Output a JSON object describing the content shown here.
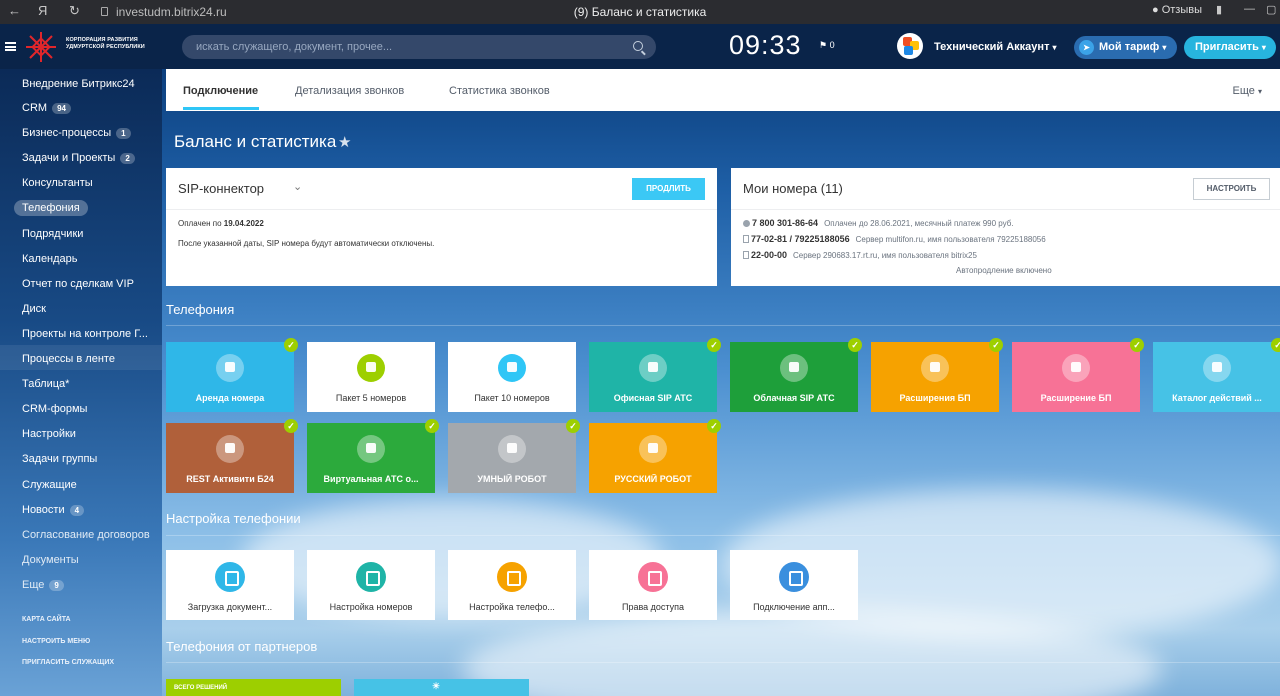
{
  "browser": {
    "url": "investudm.bitrix24.ru",
    "tab_title": "(9) Баланс и статистика",
    "feedback": "Отзывы"
  },
  "header": {
    "logo_line1": "КОРПОРАЦИЯ РАЗВИТИЯ",
    "logo_line2": "УДМУРТСКОЙ РЕСПУБЛИКИ",
    "search_placeholder": "искать служащего, документ, прочее...",
    "clock": "09:33",
    "flag_count": "0",
    "account_name": "Технический Аккаунт",
    "tariff_label": "Мой тариф",
    "invite_label": "Пригласить"
  },
  "sidebar": {
    "items": [
      {
        "label": "Внедрение Битрикс24",
        "count": ""
      },
      {
        "label": "CRM",
        "count": "94"
      },
      {
        "label": "Бизнес-процессы",
        "count": "1"
      },
      {
        "label": "Задачи и Проекты",
        "count": "2"
      },
      {
        "label": "Консультанты",
        "count": ""
      },
      {
        "label": "Телефония",
        "count": ""
      },
      {
        "label": "Подрядчики",
        "count": ""
      },
      {
        "label": "Календарь",
        "count": ""
      },
      {
        "label": "Отчет по сделкам VIP",
        "count": ""
      },
      {
        "label": "Диск",
        "count": ""
      },
      {
        "label": "Проекты на контроле Г...",
        "count": ""
      },
      {
        "label": "Процессы в ленте",
        "count": ""
      },
      {
        "label": "Таблица*",
        "count": ""
      },
      {
        "label": "CRM-формы",
        "count": ""
      },
      {
        "label": "Настройки",
        "count": ""
      },
      {
        "label": "Задачи группы",
        "count": ""
      },
      {
        "label": "Служащие",
        "count": ""
      },
      {
        "label": "Новости",
        "count": "4"
      },
      {
        "label": "Согласование договоров",
        "count": ""
      },
      {
        "label": "Документы",
        "count": ""
      },
      {
        "label": "Еще",
        "count": "9"
      }
    ],
    "links": [
      "КАРТА САЙТА",
      "НАСТРОИТЬ МЕНЮ",
      "ПРИГЛАСИТЬ СЛУЖАЩИХ"
    ]
  },
  "tabs": {
    "items": [
      "Подключение",
      "Детализация звонков",
      "Статистика звонков"
    ],
    "more": "Еще"
  },
  "page_title": "Баланс и статистика",
  "sip_card": {
    "title": "SIP-коннектор",
    "button": "ПРОДЛИТЬ",
    "paid_prefix": "Оплачен по",
    "paid_date": "19.04.2022",
    "note": "После указанной даты, SIP номера будут автоматически отключены."
  },
  "numbers_card": {
    "title": "Мои номера (11)",
    "button": "НАСТРОИТЬ",
    "rows": [
      {
        "number": "7 800 301-86-64",
        "desc": "Оплачен до 28.06.2021, месячный платеж 990 руб."
      },
      {
        "number": "77-02-81 / 79225188056",
        "desc": "Сервер multifon.ru, имя пользователя 79225188056"
      },
      {
        "number": "22-00-00",
        "desc": "Сервер 290683.17.rt.ru, имя пользователя bitrix25"
      }
    ],
    "autorenew": "Автопродление включено"
  },
  "sections": {
    "telephony": "Телефония",
    "settings": "Настройка телефонии",
    "partners": "Телефония от партнеров"
  },
  "telephony_tiles": [
    {
      "label": "Аренда номера",
      "color": "#2fb7e8"
    },
    {
      "label": "Пакет 5 номеров",
      "color": "#ffffff"
    },
    {
      "label": "Пакет 10 номеров",
      "color": "#ffffff"
    },
    {
      "label": "Офисная SIP АТС",
      "color": "#1fb4a7"
    },
    {
      "label": "Облачная SIP АТС",
      "color": "#1e9f3a"
    },
    {
      "label": "Расширения БП",
      "color": "#f6a200"
    },
    {
      "label": "Расширение БП",
      "color": "#f77296"
    },
    {
      "label": "Каталог действий ...",
      "color": "#46c2e6"
    },
    {
      "label": "REST Активити Б24",
      "color": "#b0603a"
    },
    {
      "label": "Виртуальная АТС о...",
      "color": "#2caa3c"
    },
    {
      "label": "УМНЫЙ РОБОТ",
      "color": "#a3a8ad"
    },
    {
      "label": "РУССКИЙ РОБОТ",
      "color": "#f6a200"
    }
  ],
  "settings_tiles": [
    {
      "label": "Загрузка документ...",
      "color": "#2fb7e8"
    },
    {
      "label": "Настройка номеров",
      "color": "#1fb4a7"
    },
    {
      "label": "Настройка телефо...",
      "color": "#f6a200"
    },
    {
      "label": "Права доступа",
      "color": "#f77296"
    },
    {
      "label": "Подключение апп...",
      "color": "#3a8fde"
    }
  ],
  "partners": {
    "first_label": "ВСЕГО РЕШЕНИЙ"
  }
}
